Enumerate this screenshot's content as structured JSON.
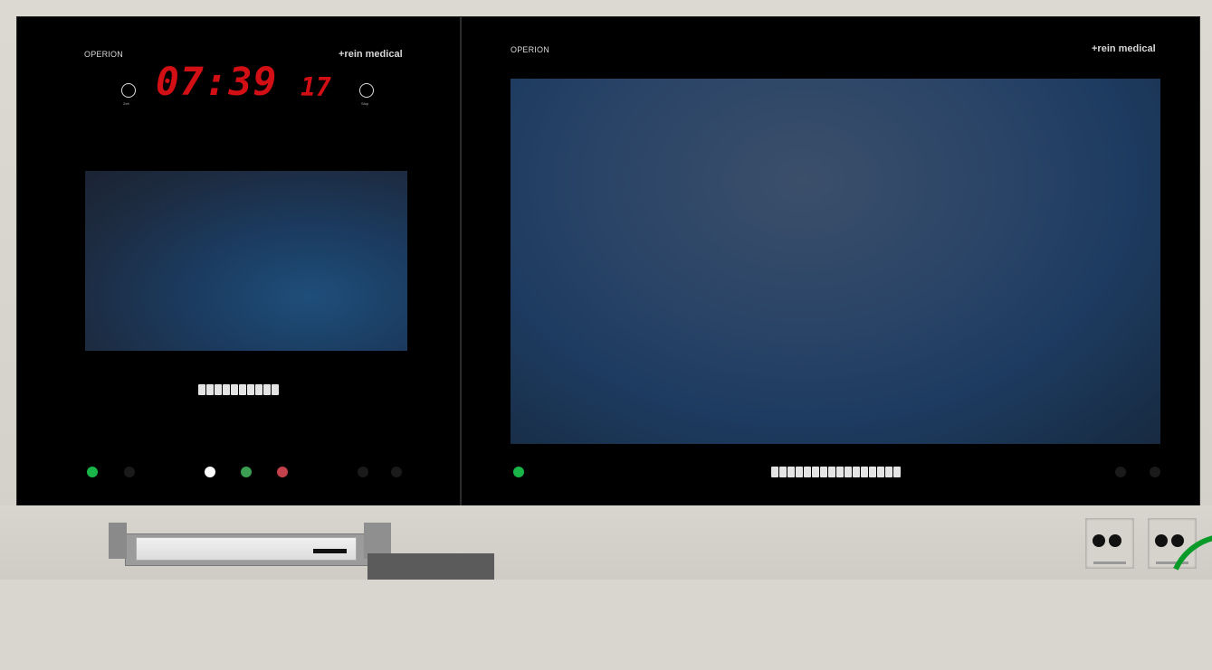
{
  "left_panel": {
    "brand": "OPERION",
    "logo": "+rein medical",
    "clock": {
      "time": "07:39",
      "seconds": "17"
    },
    "stopwatch_left_label": "Zeit",
    "stopwatch_right_label": "Stop",
    "icon_row": [
      "",
      "",
      "",
      "",
      "",
      "",
      "",
      "",
      "",
      ""
    ]
  },
  "right_panel": {
    "brand": "OPERION",
    "logo": "+rein medical",
    "icon_row": [
      "",
      "",
      "",
      "",
      "",
      "",
      "",
      "",
      "",
      "",
      "",
      "",
      "",
      "",
      "",
      "",
      "",
      ""
    ]
  },
  "colors": {
    "clock_digits": "#d10f14",
    "led_green": "#19b548",
    "led_white": "#ffffff",
    "led_green_dim": "#3a9f52",
    "led_red": "#c2414a"
  }
}
